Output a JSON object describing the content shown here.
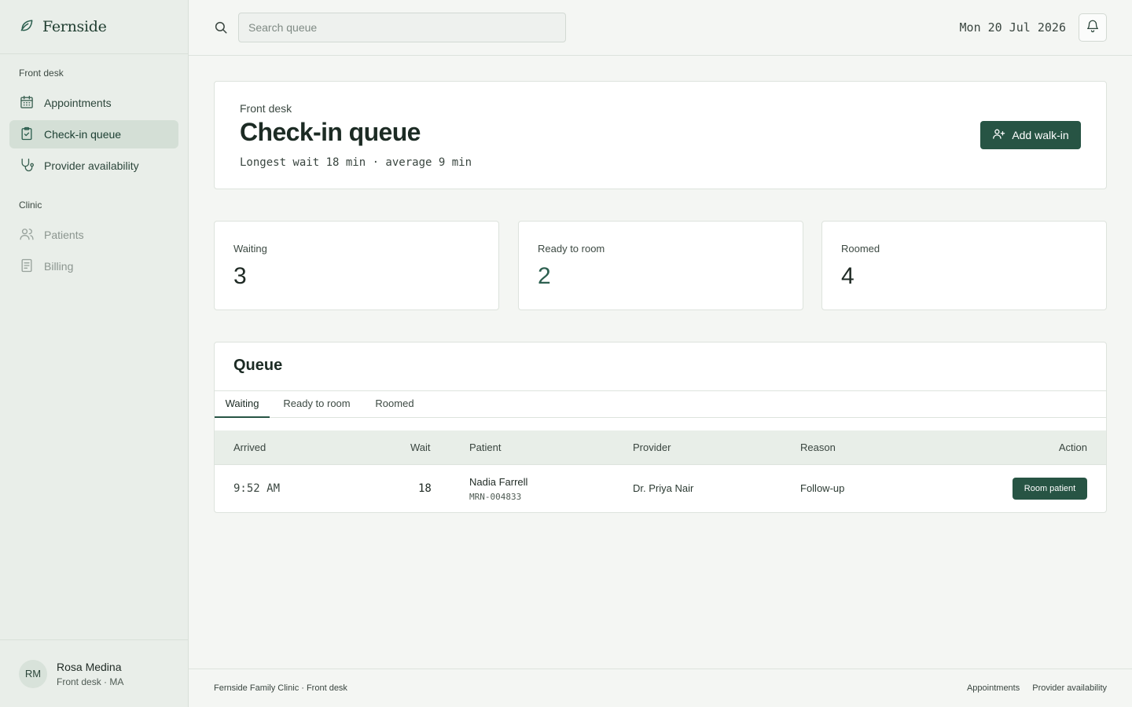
{
  "brand": {
    "name": "Fernside"
  },
  "sidebar": {
    "sections": [
      {
        "label": "Front desk"
      },
      {
        "label": "Clinic"
      }
    ],
    "items": [
      {
        "label": "Appointments",
        "icon": "calendar-icon",
        "active": false
      },
      {
        "label": "Check-in queue",
        "icon": "clipboard-check-icon",
        "active": true
      },
      {
        "label": "Provider availability",
        "icon": "stethoscope-icon",
        "active": false
      },
      {
        "label": "Patients",
        "icon": "users-icon",
        "active": false
      },
      {
        "label": "Billing",
        "icon": "receipt-icon",
        "active": false
      }
    ]
  },
  "user": {
    "initials": "RM",
    "name": "Rosa Medina",
    "role": "Front desk · MA"
  },
  "topbar": {
    "search_placeholder": "Search queue",
    "search_value": "",
    "date": "Mon 20 Jul 2026"
  },
  "header": {
    "eyebrow": "Front desk",
    "title": "Check-in queue",
    "subtitle": "Longest wait 18 min · average 9 min",
    "add_button": "Add walk-in"
  },
  "stats": [
    {
      "label": "Waiting",
      "value": "3"
    },
    {
      "label": "Ready to room",
      "value": "2"
    },
    {
      "label": "Roomed",
      "value": "4"
    }
  ],
  "queue": {
    "title": "Queue",
    "tabs": [
      {
        "label": "Waiting",
        "active": true
      },
      {
        "label": "Ready to room",
        "active": false
      },
      {
        "label": "Roomed",
        "active": false
      }
    ],
    "columns": [
      "Arrived",
      "Wait",
      "Patient",
      "Provider",
      "Reason",
      "Action"
    ],
    "rows": [
      {
        "arrived": "9:52 AM",
        "wait": "18",
        "patient_name": "Nadia Farrell",
        "mrn": "MRN-004833",
        "provider": "Dr. Priya Nair",
        "reason": "Follow-up",
        "action": "Room patient"
      }
    ]
  },
  "footer": {
    "left": "Fernside Family Clinic · Front desk",
    "links": [
      "Appointments",
      "Provider availability"
    ]
  },
  "colors": {
    "accent": "#275444",
    "sidebar_bg": "#e9eee9",
    "page_bg": "#f4f6f3",
    "active_nav_bg": "#d4dfd6"
  }
}
